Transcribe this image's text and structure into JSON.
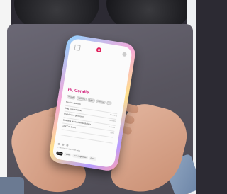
{
  "app": {
    "greeting": "Hi, Coralie.",
    "icons": [
      "menu-icon",
      "logo-icon",
      "settings-icon"
    ],
    "accent_color": "#d21f7a",
    "filters": [
      "View all",
      "Marketing",
      "Sales",
      "Business",
      "UX"
    ],
    "rows": [
      {
        "title": "Ha view citations",
        "meta": ""
      },
      {
        "title": "Blog & Brand Writer",
        "meta": "Marketing"
      },
      {
        "title": "Brand name generator",
        "meta": "Marketing"
      },
      {
        "title": "Business Model Canvas Builder",
        "meta": "Business"
      },
      {
        "title": "Cold Call Script",
        "meta": "Sales"
      },
      {
        "title": "",
        "meta": ""
      }
    ],
    "bottom_note": "ⓘ What can I help you with today",
    "tabs": [
      "Chat",
      "Tools",
      "Knowledge Base",
      "Plans"
    ]
  }
}
